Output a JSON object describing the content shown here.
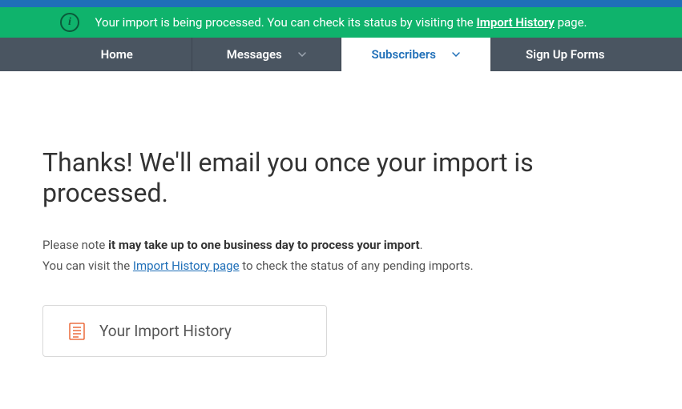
{
  "notification": {
    "text_before": "Your import is being processed. You can check its status by visiting the ",
    "link": "Import History",
    "text_after": " page."
  },
  "nav": {
    "home": "Home",
    "messages": "Messages",
    "subscribers": "Subscribers",
    "signup_forms": "Sign Up Forms"
  },
  "content": {
    "heading": "Thanks! We'll email you once your import is processed.",
    "para1_before": "Please note ",
    "para1_bold": "it may take up to one business day to process your import",
    "para1_after": ".",
    "para2_before": "You can visit the ",
    "para2_link": "Import History page",
    "para2_after": " to check the status of any pending imports.",
    "button_label": "Your Import History"
  }
}
